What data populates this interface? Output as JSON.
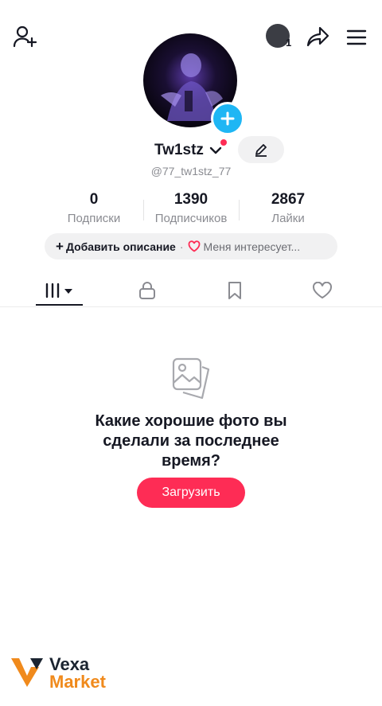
{
  "header": {
    "add_friend_icon": "person-plus-icon",
    "notification_count": "1",
    "share_icon": "share-arrow-icon",
    "menu_icon": "hamburger-icon"
  },
  "profile": {
    "avatar_add_icon": "plus-icon",
    "name": "Tw1stz",
    "handle": "@77_tw1stz_77",
    "edit_icon": "pencil-icon"
  },
  "stats": [
    {
      "value": "0",
      "label": "Подписки"
    },
    {
      "value": "1390",
      "label": "Подписчиков"
    },
    {
      "value": "2867",
      "label": "Лайки"
    }
  ],
  "bio": {
    "add_plus": "+",
    "add_label": "Добавить описание",
    "separator": "·",
    "interests_label": "Меня интересует..."
  },
  "tabs": [
    {
      "icon": "grid-icon"
    },
    {
      "icon": "lock-icon"
    },
    {
      "icon": "bookmark-icon"
    },
    {
      "icon": "heart-icon"
    }
  ],
  "empty_state": {
    "icon": "photos-icon",
    "message": "Какие хорошие фото вы сделали за последнее время?",
    "upload_label": "Загрузить"
  },
  "watermark": {
    "line1": "Vexa",
    "line2": "Market"
  },
  "colors": {
    "accent": "#fe2c55",
    "avatar_badge": "#1fb6f4",
    "watermark_orange": "#f08a1c"
  }
}
